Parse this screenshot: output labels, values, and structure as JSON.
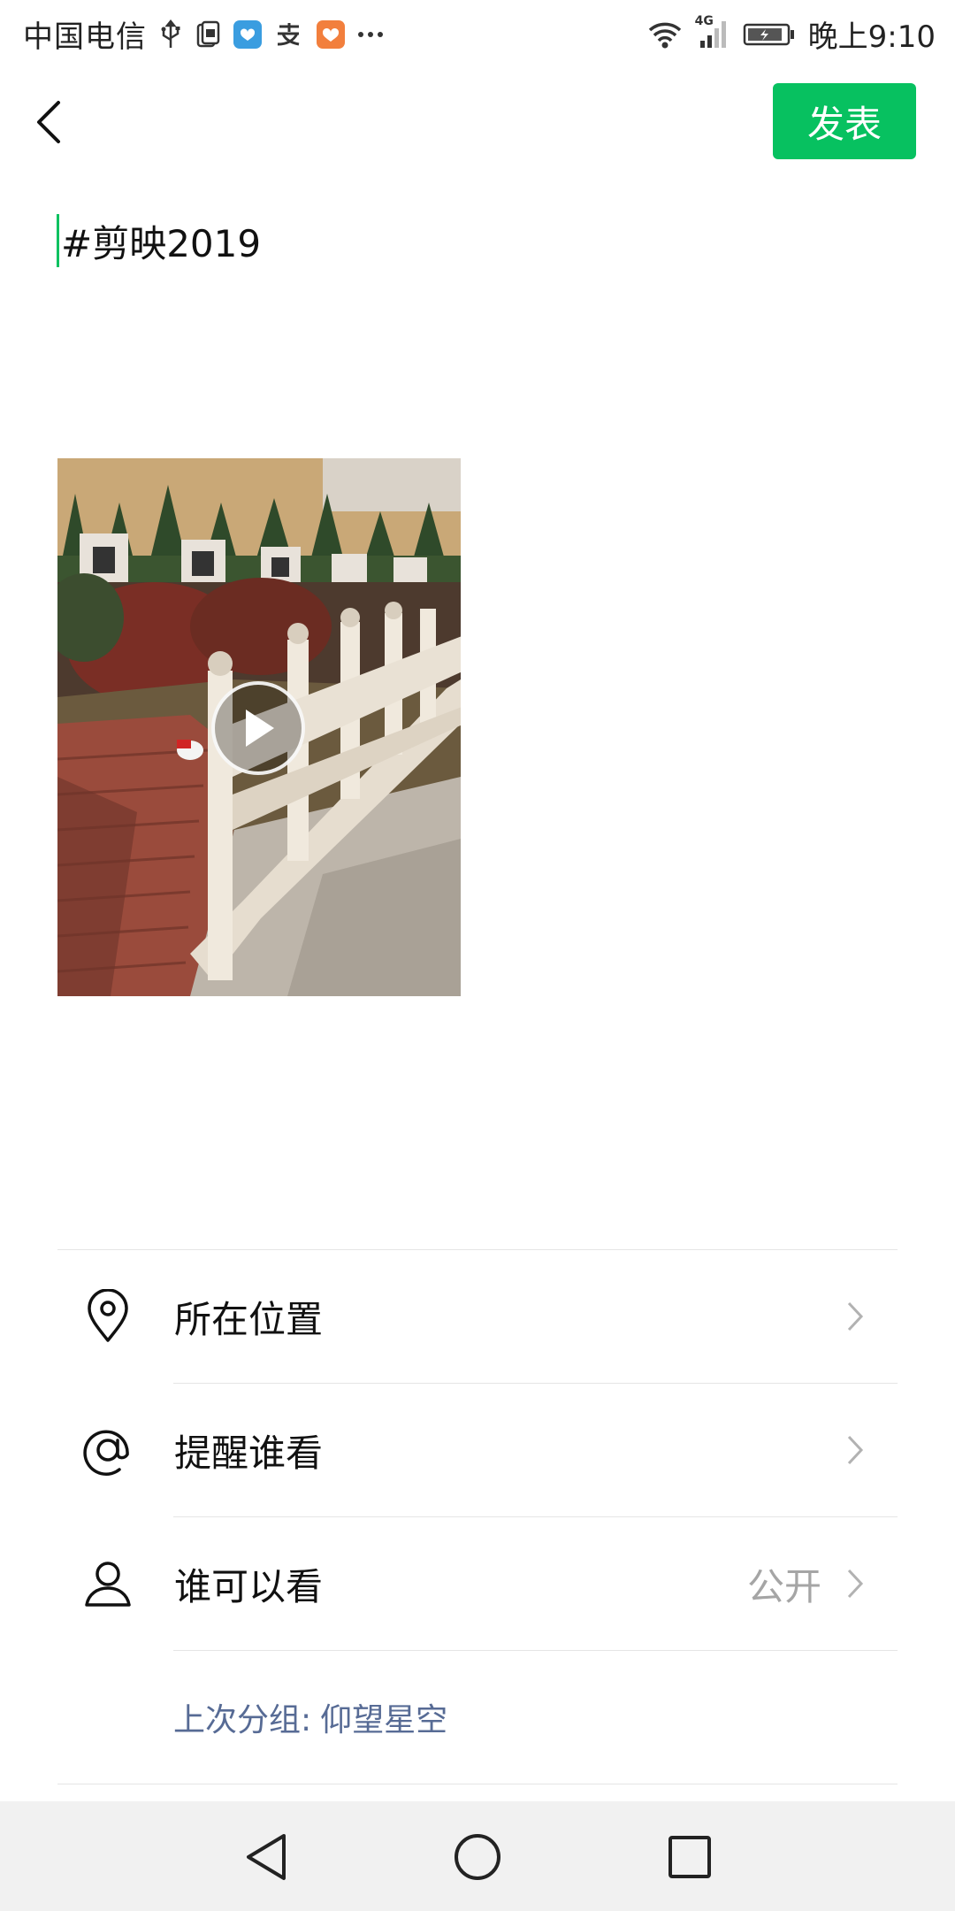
{
  "status_bar": {
    "carrier": "中国电信",
    "time": "晚上9:10",
    "network": "4G",
    "icons": [
      "usb-icon",
      "sim-icon",
      "chat-app-icon",
      "alipay-icon",
      "heart-app-icon",
      "more-dots-icon",
      "wifi-icon",
      "signal-icon",
      "battery-icon"
    ]
  },
  "header": {
    "back_icon": "back-chevron-icon",
    "publish_label": "发表",
    "accent_color": "#07c160"
  },
  "post": {
    "text": "#剪映2019"
  },
  "media": {
    "type": "video",
    "play_icon": "play-icon"
  },
  "options": [
    {
      "label": "所在位置",
      "icon": "location-pin-icon",
      "value": ""
    },
    {
      "label": "提醒谁看",
      "icon": "at-icon",
      "value": ""
    },
    {
      "label": "谁可以看",
      "icon": "person-icon",
      "value": "公开"
    }
  ],
  "last_group": {
    "label": "上次分组:",
    "value": "仰望星空",
    "color": "#576b95"
  },
  "nav": {
    "icons": [
      "nav-back-icon",
      "nav-home-icon",
      "nav-recents-icon"
    ]
  }
}
